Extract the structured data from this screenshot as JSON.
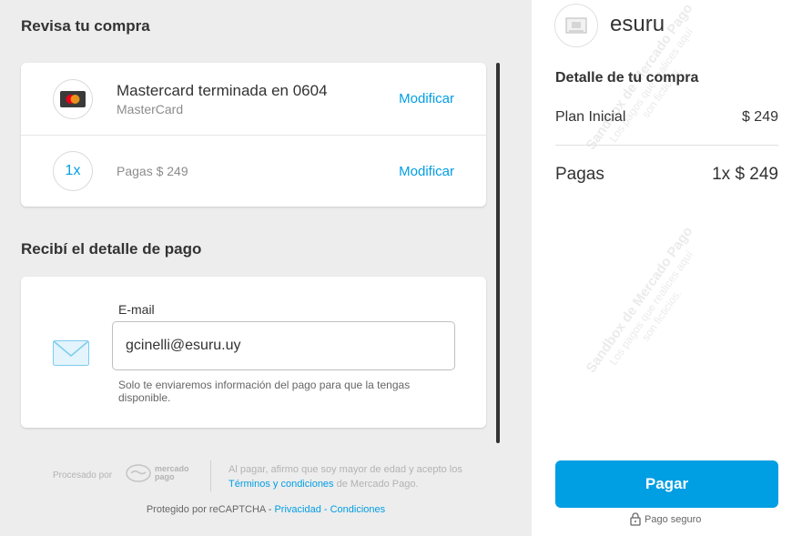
{
  "review": {
    "title": "Revisa tu compra",
    "card_row": {
      "main": "Mastercard terminada en 0604",
      "sub": "MasterCard",
      "modify": "Modificar"
    },
    "installments_row": {
      "badge": "1x",
      "text": "Pagas $ 249",
      "modify": "Modificar"
    }
  },
  "receipt": {
    "title": "Recibí el detalle de pago",
    "email_label": "E-mail",
    "email_value": "gcinelli@esuru.uy",
    "help": "Solo te enviaremos información del pago para que la tengas disponible."
  },
  "footer": {
    "processed_by": "Procesado por",
    "logo_line1": "mercado",
    "logo_line2": "pago",
    "legal_pre": "Al pagar, afirmo que soy mayor de edad y acepto los",
    "legal_link": "Términos y condiciones",
    "legal_post": "de Mercado Pago.",
    "recaptcha_pre": "Protegido por reCAPTCHA -",
    "privacy_link": "Privacidad",
    "recaptcha_sep": "-",
    "terms_link": "Condiciones"
  },
  "summary": {
    "store_name": "esuru",
    "detail_title": "Detalle de tu compra",
    "item_label": "Plan Inicial",
    "item_price": "$ 249",
    "total_label": "Pagas",
    "total_value": "1x $ 249",
    "pay_button": "Pagar",
    "secure_label": "Pago seguro"
  },
  "watermark": {
    "main": "Sandbox de Mercado Pago",
    "sub1": "Los pagos que realices aquí",
    "sub2": "son ficticios."
  },
  "colors": {
    "accent": "#009ee3",
    "background": "#ededed",
    "card": "#ffffff"
  },
  "icons": {
    "card_brand": "mastercard-icon",
    "mail": "envelope-icon",
    "lock": "lock-icon",
    "store": "store-icon",
    "mp_logo": "mercado-pago-logo"
  }
}
